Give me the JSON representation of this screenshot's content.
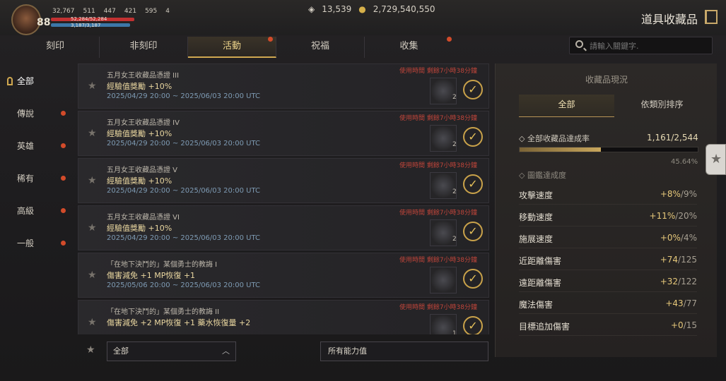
{
  "header": {
    "level": "88",
    "stats": [
      "32,767",
      "511",
      "447",
      "421",
      "595",
      "4"
    ],
    "hp": "52,284/52,284",
    "mp": "3,187/3,187",
    "currency_a": "13,539",
    "currency_b": "2,729,540,550",
    "title": "道具收藏品"
  },
  "tabs": [
    {
      "label": "刻印",
      "dot": false
    },
    {
      "label": "非刻印",
      "dot": false
    },
    {
      "label": "活動",
      "dot": true
    },
    {
      "label": "祝福",
      "dot": false
    },
    {
      "label": "收集",
      "dot": true
    }
  ],
  "search": {
    "placeholder": "請輸入關鍵字."
  },
  "sidebar": [
    {
      "label": "全部",
      "active": true
    },
    {
      "label": "傳說",
      "dot": true
    },
    {
      "label": "英雄",
      "dot": true
    },
    {
      "label": "稀有",
      "dot": true
    },
    {
      "label": "高級",
      "dot": true
    },
    {
      "label": "一般",
      "dot": true
    }
  ],
  "items": [
    {
      "name": "五月女王收藏品憑證 III",
      "bonus": "經驗值獎勵 +10%",
      "date": "2025/04/29 20:00 ~ 2025/06/03 20:00 UTC",
      "warning": "使用時間 剩餘7小時38分鐘",
      "count": "2"
    },
    {
      "name": "五月女王收藏品憑證 IV",
      "bonus": "經驗值獎勵 +10%",
      "date": "2025/04/29 20:00 ~ 2025/06/03 20:00 UTC",
      "warning": "使用時間 剩餘7小時38分鐘",
      "count": "2"
    },
    {
      "name": "五月女王收藏品憑證 V",
      "bonus": "經驗值獎勵 +10%",
      "date": "2025/04/29 20:00 ~ 2025/06/03 20:00 UTC",
      "warning": "使用時間 剩餘7小時38分鐘",
      "count": "2"
    },
    {
      "name": "五月女王收藏品憑證 VI",
      "bonus": "經驗值獎勵 +10%",
      "date": "2025/04/29 20:00 ~ 2025/06/03 20:00 UTC",
      "warning": "使用時間 剩餘7小時38分鐘",
      "count": "2"
    },
    {
      "name": "「在地下決鬥的」某個勇士的教誨 I",
      "bonus": "傷害減免 +1 MP恢復 +1",
      "date": "2025/05/06 20:00 ~ 2025/06/03 20:00 UTC",
      "warning": "使用時間 剩餘7小時38分鐘",
      "count": ""
    },
    {
      "name": "「在地下決鬥的」某個勇士的教誨 II",
      "bonus": "傷害減免 +2 MP恢復 +1 藥水恢復量 +2",
      "date": "",
      "warning": "使用時間 剩餘7小時38分鐘",
      "count": "1"
    }
  ],
  "bottom": {
    "sort": "全部",
    "filter": "所有能力值"
  },
  "panel": {
    "title": "收藏品現況",
    "tabs": [
      "全部",
      "依類別排序"
    ],
    "rate_label": "全部收藏品達成率",
    "rate_value": "1,161/2,544",
    "rate_pct": "45.64%",
    "rate_fraction": 0.4564,
    "book_label": "圖鑑達成度",
    "stats": [
      {
        "label": "攻擊速度",
        "cur": "+8%",
        "max": "/9%"
      },
      {
        "label": "移動速度",
        "cur": "+11%",
        "max": "/20%"
      },
      {
        "label": "施展速度",
        "cur": "+0%",
        "max": "/4%"
      },
      {
        "label": "近距離傷害",
        "cur": "+74",
        "max": "/125"
      },
      {
        "label": "遠距離傷害",
        "cur": "+32",
        "max": "/122"
      },
      {
        "label": "魔法傷害",
        "cur": "+43",
        "max": "/77"
      },
      {
        "label": "目標追加傷害",
        "cur": "+0",
        "max": "/15"
      }
    ]
  }
}
